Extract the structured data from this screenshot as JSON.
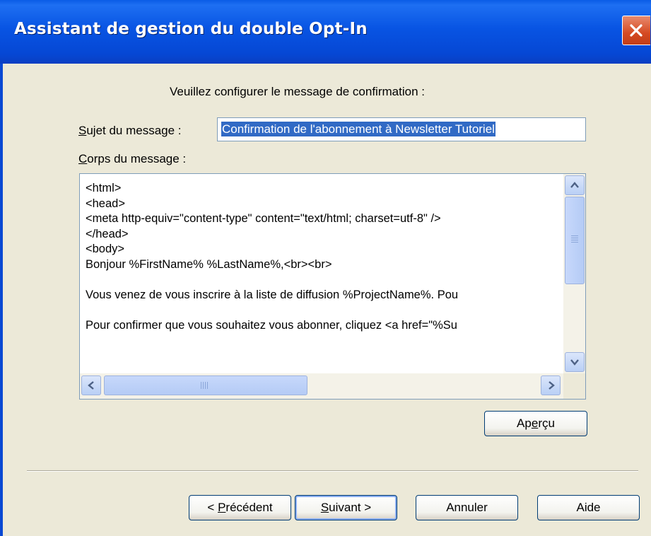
{
  "window": {
    "title": "Assistant de gestion du double Opt-In"
  },
  "prompt": "Veuillez configurer le message de confirmation :",
  "subject": {
    "label_first": "S",
    "label_rest": "ujet du message :",
    "value": "Confirmation de l'abonnement à Newsletter Tutoriel"
  },
  "body": {
    "label_first": "C",
    "label_rest": "orps du message :",
    "content": "<html>\n<head>\n<meta http-equiv=\"content-type\" content=\"text/html; charset=utf-8\" />\n</head>\n<body>\nBonjour %FirstName% %LastName%,<br><br>\n\nVous venez de vous inscrire à la liste de diffusion %ProjectName%. Pou\n\nPour confirmer que vous souhaitez vous abonner, cliquez <a href=\"%Su"
  },
  "buttons": {
    "preview_pre": "Ap",
    "preview_u": "e",
    "preview_post": "rçu",
    "previous_pre": "< ",
    "previous_u": "P",
    "previous_post": "récédent",
    "next_u": "S",
    "next_post": "uivant >",
    "cancel": "Annuler",
    "help": "Aide"
  },
  "colors": {
    "title_bar": "#0854e3",
    "window_bg": "#ece9d8",
    "selection": "#316ac5"
  }
}
